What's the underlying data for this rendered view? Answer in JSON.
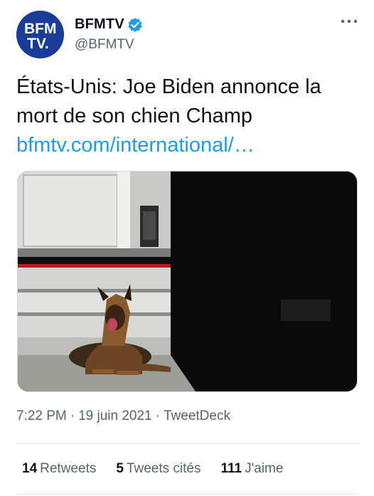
{
  "account": {
    "avatar_text_line1": "BFM",
    "avatar_text_line2": "TV.",
    "display_name": "BFMTV",
    "handle": "@BFMTV"
  },
  "tweet": {
    "text": "États-Unis: Joe Biden annonce la mort de son chien Champ",
    "link": "bfmtv.com/international/…",
    "time": "7:22 PM",
    "date": "19 juin 2021",
    "source": "TweetDeck"
  },
  "stats": {
    "retweets_count": "14",
    "retweets_label": "Retweets",
    "quotes_count": "5",
    "quotes_label": "Tweets cités",
    "likes_count": "111",
    "likes_label": "J'aime"
  },
  "colors": {
    "brand_blue": "#1a3c99",
    "verified_blue": "#1d9bf0",
    "link_blue": "#1d9bf0",
    "secondary_text": "#536471"
  },
  "icons": [
    "bfmtv-logo-avatar",
    "verified-badge-icon",
    "more-options-icon"
  ]
}
